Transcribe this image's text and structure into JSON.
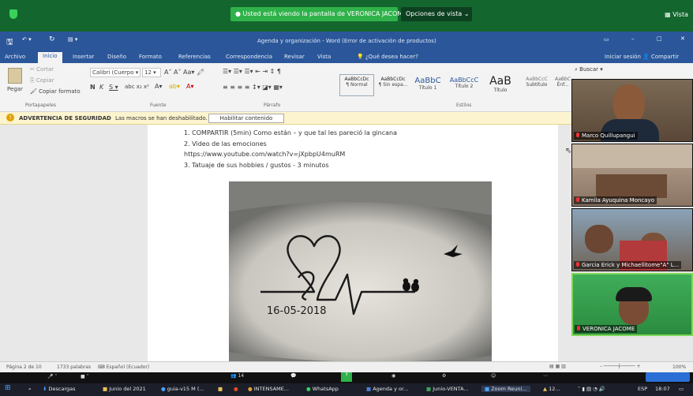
{
  "zoom": {
    "share_banner": "Usted está viendo la pantalla de VERONICA JACOME",
    "view_options": "Opciones de vista",
    "view_label": "Vista",
    "participants_count": "14"
  },
  "word": {
    "title": "Agenda y organización - Word (Error de activación de productos)",
    "sign_in": "Iniciar sesión",
    "share": "Compartir",
    "tabs": [
      "Archivo",
      "Inicio",
      "Insertar",
      "Diseño",
      "Formato",
      "Referencias",
      "Correspondencia",
      "Revisar",
      "Vista"
    ],
    "tell_me": "¿Qué desea hacer?",
    "clipboard": {
      "paste": "Pegar",
      "cut": "Cortar",
      "copy": "Copiar",
      "format_painter": "Copiar formato",
      "label": "Portapapeles"
    },
    "font": {
      "name": "Calibri (Cuerpo",
      "size": "12",
      "label": "Fuente"
    },
    "paragraph_label": "Párrafo",
    "styles_label": "Estilos",
    "styles": [
      {
        "preview": "AaBbCcDc",
        "name": "¶ Normal"
      },
      {
        "preview": "AaBbCcDc",
        "name": "¶ Sin espa..."
      },
      {
        "preview": "AaBbC",
        "name": "Título 1"
      },
      {
        "preview": "AaBbCcC",
        "name": "Título 2"
      },
      {
        "preview": "AaB",
        "name": "Título"
      },
      {
        "preview": "AaBbCcC",
        "name": "Subtítulo"
      },
      {
        "preview": "AaBbCcDc",
        "name": "Énf..."
      }
    ],
    "search": "Buscar",
    "warning_title": "ADVERTENCIA DE SEGURIDAD",
    "warning_text": "Las macros se han deshabilitado.",
    "enable_button": "Habilitar contenido",
    "doc_lines": [
      "1.   COMPARTIR (5min) Como están – y que tal les pareció la gincana",
      "2.   Video de las emociones",
      "      https://www.youtube.com/watch?v=jXpbpU4muRM",
      "3.   Tatuaje de sus hobbies / gustos - 3 minutos"
    ],
    "tattoo_date": "16-05-2018",
    "status": {
      "page": "Página 2 de 10",
      "words": "1733 palabras",
      "language": "Español (Ecuador)",
      "zoom": "100%"
    }
  },
  "participants": [
    {
      "name": "Marco Quillupangui"
    },
    {
      "name": "Kamila Ayuquina Moncayo"
    },
    {
      "name": "Garcia Erick y Michaellitome\"A\" L..."
    },
    {
      "name": "VERONICA JACOME"
    }
  ],
  "taskbar": {
    "items": [
      "Descargas",
      "Junio del 2021",
      "guia-v15 M (...",
      "INTENSAME...",
      "WhatsApp",
      "Agenda y or...",
      "Junio-VENTA...",
      "Zoom Reuni..."
    ],
    "tray_text": "12...",
    "lang": "ESP",
    "time": "18:07"
  },
  "colors": {
    "word_blue": "#2b579a",
    "zoom_green": "#2fb24a",
    "warning_bg": "#fcf4cf"
  }
}
